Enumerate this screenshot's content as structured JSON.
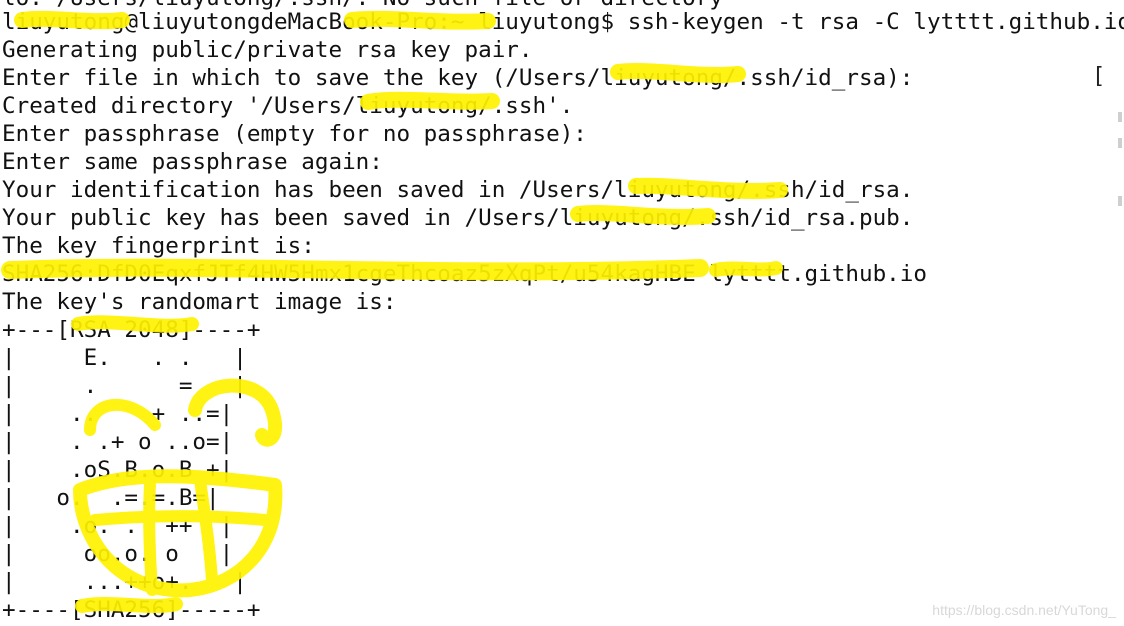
{
  "terminal": {
    "lines": [
      "lo: /Users/liuyutong/.ssh/: No such file or directory",
      "liuyutong@liuyutongdeMacBook-Pro:~ liuyutong$ ssh-keygen -t rsa -C lytttt.github.io",
      "Generating public/private rsa key pair.",
      "Enter file in which to save the key (/Users/liuyutong/.ssh/id_rsa):",
      "Created directory '/Users/liuyutong/.ssh'.",
      "Enter passphrase (empty for no passphrase):",
      "Enter same passphrase again:",
      "Your identification has been saved in /Users/liuyutong/.ssh/id_rsa.",
      "Your public key has been saved in /Users/liuyutong/.ssh/id_rsa.pub.",
      "The key fingerprint is:",
      "SHA256:DfD0EqxfJTf4HW5Hmx1cgeThcoaz5zXqPt/u54kagHBE lytttt.github.io",
      "The key's randomart image is:",
      "+---[RSA 2048]----+",
      "|     E.   . .   |",
      "|     .      =   |",
      "|    ..    + ..=|",
      "|    . .+ o ..o=|",
      "|    .oS.B.o.B +|",
      "|   o.  .=.=.B=|",
      "|    .o. .  ++  |",
      "|     oo.o. o   |",
      "|     ...++o+.   |",
      "+----[SHA256]-----+"
    ],
    "side_bracket": "["
  },
  "watermark": "https://blog.csdn.net/YuTong_"
}
